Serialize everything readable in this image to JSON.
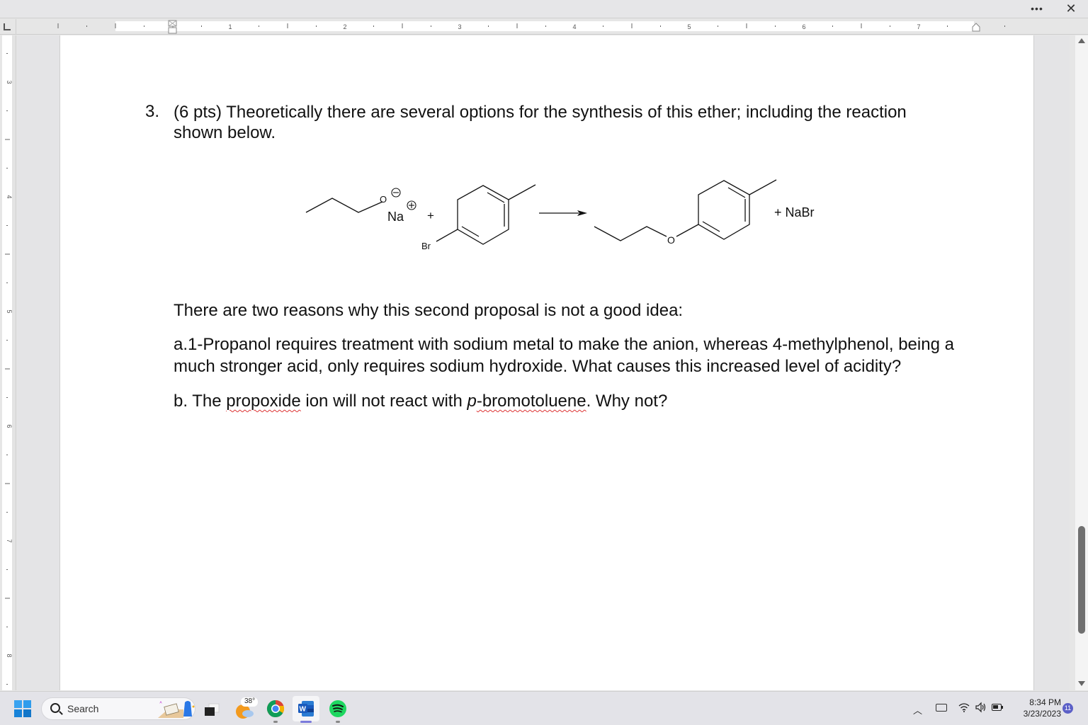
{
  "window": {
    "more_label": "•••",
    "close_label": "✕"
  },
  "ruler": {
    "horizontal_numbers": [
      "1",
      "2",
      "3",
      "4",
      "5",
      "6",
      "7"
    ],
    "vertical_numbers": [
      "3",
      "4",
      "5",
      "6",
      "7",
      "8"
    ]
  },
  "document": {
    "question_number": "3.",
    "question_text": "(6 pts) Theoretically there are several options for the synthesis of this ether; including the reaction shown below.",
    "reaction": {
      "reactant1_atom_O": "O",
      "reactant1_counterion": "Na",
      "charge_negative": "−",
      "charge_positive": "+",
      "plus_sign": "+",
      "reactant2_atom_Br": "Br",
      "product_atom_O": "O",
      "byproduct": "+ NaBr"
    },
    "intro": "There are two reasons why this second proposal is not a good idea:",
    "part_a": "a.1-Propanol requires treatment with sodium metal to make the anion, whereas 4-methylphenol, being a much stronger acid, only requires sodium hydroxide. What causes this increased level of acidity?",
    "part_b": {
      "prefix": "b. The ",
      "word1": "propoxide",
      "mid": " ion will not react with ",
      "italic_p": "p",
      "word2": "-bromotoluene",
      "suffix": ". Why not?"
    }
  },
  "taskbar": {
    "search_label": "Search",
    "weather_temp": "38°",
    "apps": [
      {
        "name": "Task View",
        "icon": "task-view-icon"
      },
      {
        "name": "Weather",
        "icon": "weather-icon"
      },
      {
        "name": "Google Chrome",
        "icon": "chrome-icon"
      },
      {
        "name": "Microsoft Word",
        "icon": "word-icon",
        "active": true
      },
      {
        "name": "Spotify",
        "icon": "spotify-icon"
      }
    ],
    "time": "8:34 PM",
    "date": "3/23/2023",
    "notification_count": "11"
  },
  "colors": {
    "word_blue": "#185abd",
    "spotify_green": "#1ed760",
    "spellcheck_red": "#d33333",
    "notification_purple": "#5b5fc7"
  }
}
